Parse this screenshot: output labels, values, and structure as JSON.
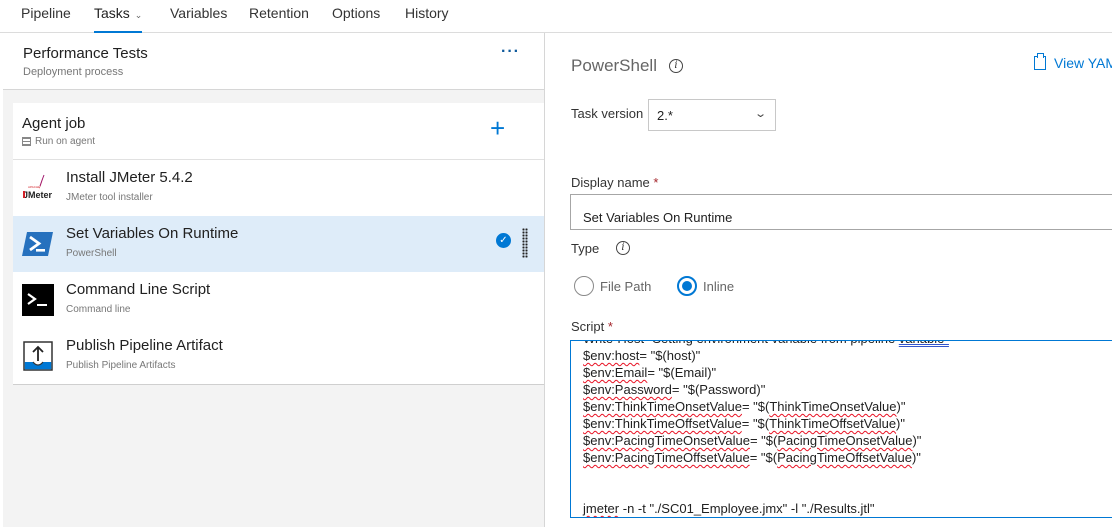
{
  "tabs": [
    {
      "label": "Pipeline"
    },
    {
      "label": "Tasks",
      "active": true,
      "has_dropdown": true
    },
    {
      "label": "Variables"
    },
    {
      "label": "Retention"
    },
    {
      "label": "Options"
    },
    {
      "label": "History"
    }
  ],
  "process": {
    "title": "Performance Tests",
    "subtitle": "Deployment process",
    "more_icon": "ellipsis-icon"
  },
  "job": {
    "title": "Agent job",
    "subtitle": "Run on agent",
    "add_icon": "plus-icon"
  },
  "tasks": [
    {
      "title": "Install JMeter 5.4.2",
      "subtitle": "JMeter tool installer",
      "icon": "jmeter-logo-icon"
    },
    {
      "title": "Set Variables On Runtime",
      "subtitle": "PowerShell",
      "icon": "powershell-icon",
      "selected": true
    },
    {
      "title": "Command Line Script",
      "subtitle": "Command line",
      "icon": "terminal-icon"
    },
    {
      "title": "Publish Pipeline Artifact",
      "subtitle": "Publish Pipeline Artifacts",
      "icon": "upload-artifact-icon"
    }
  ],
  "detail": {
    "title": "PowerShell",
    "view_yaml": "View YAML",
    "task_version_label": "Task version",
    "task_version_value": "2.*",
    "display_name_label": "Display name",
    "display_name_value": "Set Variables On Runtime",
    "required_mark": "*",
    "type_label": "Type",
    "type_options": [
      "File Path",
      "Inline"
    ],
    "type_selected": "Inline",
    "script_label": "Script",
    "script_lines": [
      "Write-Host \"Setting environment variable from pipeline variable\"",
      "$env:host= \"$(host)\"",
      "$env:Email= \"$(Email)\"",
      "$env:Password= \"$(Password)\"",
      "$env:ThinkTimeOnsetValue= \"$(ThinkTimeOnsetValue)\"",
      "$env:ThinkTimeOffsetValue= \"$(ThinkTimeOffsetValue)\"",
      "$env:PacingTimeOnsetValue= \"$(PacingTimeOnsetValue)\"",
      "$env:PacingTimeOffsetValue= \"$(PacingTimeOffsetValue)\"",
      "",
      "",
      "jmeter -n -t \"./SC01_Employee.jmx\" -l \"./Results.jtl\""
    ]
  },
  "colors": {
    "accent": "#0078d4",
    "selected_row": "#deecf9",
    "required": "#a4262c"
  }
}
